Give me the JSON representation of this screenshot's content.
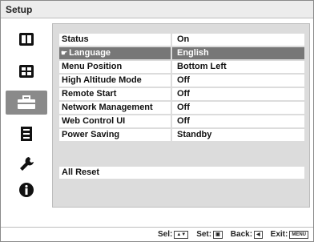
{
  "title": "Setup",
  "sidebar": {
    "items": [
      {
        "icon": "picture-icon",
        "active": false
      },
      {
        "icon": "screen-icon",
        "active": false
      },
      {
        "icon": "setup-toolbox-icon",
        "active": true
      },
      {
        "icon": "installation-icon",
        "active": false
      },
      {
        "icon": "function-wrench-icon",
        "active": false
      },
      {
        "icon": "information-icon",
        "active": false
      }
    ]
  },
  "settings": [
    {
      "label": "Status",
      "value": "On"
    },
    {
      "label": "Language",
      "value": "English",
      "selected": true
    },
    {
      "label": "Menu Position",
      "value": "Bottom Left"
    },
    {
      "label": "High Altitude Mode",
      "value": "Off"
    },
    {
      "label": "Remote Start",
      "value": "Off"
    },
    {
      "label": "Network Management",
      "value": "Off"
    },
    {
      "label": "Web Control UI",
      "value": "Off"
    },
    {
      "label": "Power Saving",
      "value": "Standby"
    }
  ],
  "reset": {
    "label": "All Reset"
  },
  "footer": {
    "sel_label": "Sel:",
    "set_label": "Set:",
    "back_label": "Back:",
    "exit_label": "Exit:",
    "sel_key": "▲▼",
    "set_key": "▣",
    "back_key": "◀",
    "exit_key": "MENU"
  }
}
